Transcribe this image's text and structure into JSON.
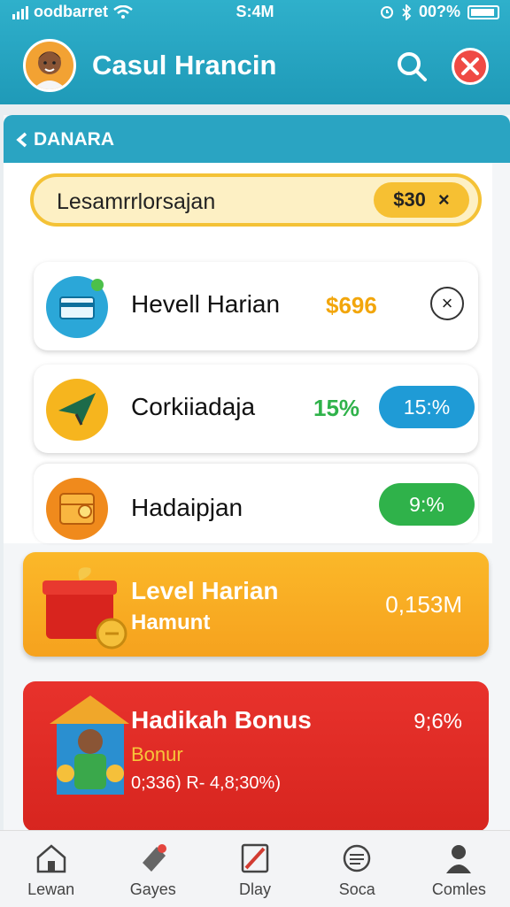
{
  "status_bar": {
    "carrier": "oodbarret",
    "time": "S:4M",
    "battery": "00?%"
  },
  "header": {
    "title": "Casul Hrancin",
    "avatar_icon": "user-avatar",
    "search_icon": "search-icon",
    "close_icon": "close-icon"
  },
  "subheader": {
    "back_label": "DANARA"
  },
  "search": {
    "text": "Lesamrrlorsajan",
    "price": "$30",
    "clear": "×"
  },
  "items": [
    {
      "label": "Hevell Harian",
      "value": "$696",
      "value_color": "#f2a60c",
      "icon": "card-icon",
      "icon_bg": "#2ba7d8",
      "action": "×"
    },
    {
      "label": "Corkiiadaja",
      "value": "15%",
      "value_color": "#2fb24a",
      "icon": "plane-icon",
      "icon_bg": "#f6b51e",
      "pill": "15:%",
      "pill_color": "#1f9bd6"
    },
    {
      "label": "Hadaipjan",
      "icon": "treasure-icon",
      "icon_bg": "#f08a1c",
      "pill": "9:%",
      "pill_color": "#2fb24a"
    }
  ],
  "banners": [
    {
      "title": "Level Harian",
      "subtitle": "Hamunt",
      "value": "0,153M",
      "icon": "gift-box-icon"
    },
    {
      "title": "Hadikah Bonus",
      "subtitle": "Bonur",
      "detail": "0;336) R- 4,8;30%)",
      "value": "9;6%",
      "icon": "characters-icon"
    }
  ],
  "nav": [
    {
      "label": "Lewan",
      "icon": "home-icon"
    },
    {
      "label": "Gayes",
      "icon": "ticket-icon"
    },
    {
      "label": "Dlay",
      "icon": "play-icon"
    },
    {
      "label": "Soca",
      "icon": "chat-icon"
    },
    {
      "label": "Comles",
      "icon": "profile-icon"
    }
  ],
  "colors": {
    "header": "#24a5c2",
    "accent_yellow": "#f6c033",
    "banner_orange": "#f8ac22",
    "banner_red": "#de2a24"
  }
}
